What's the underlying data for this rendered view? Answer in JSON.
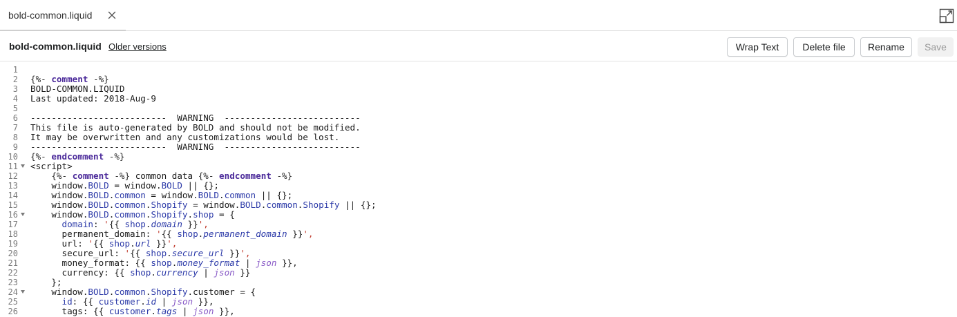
{
  "tab": {
    "label": "bold-common.liquid",
    "close_icon": "close-icon"
  },
  "toolbar": {
    "expand_icon": "expand-icon",
    "file_title": "bold-common.liquid",
    "older_versions": "Older versions",
    "wrap_text": "Wrap Text",
    "delete_file": "Delete file",
    "rename": "Rename",
    "save": "Save"
  },
  "colors": {
    "keyword": "#4b2a9a",
    "object": "#2c3aa8",
    "string": "#c0392b",
    "filter": "#8a5cc7",
    "line_number": "#7a7a7a"
  },
  "editor": {
    "lines": [
      {
        "n": "1",
        "fold": false,
        "tokens": []
      },
      {
        "n": "2",
        "fold": false,
        "tokens": [
          [
            "d",
            "{%- "
          ],
          [
            "k",
            "comment"
          ],
          [
            "d",
            " -%}"
          ]
        ]
      },
      {
        "n": "3",
        "fold": false,
        "tokens": [
          [
            "t",
            "BOLD-COMMON.LIQUID"
          ]
        ]
      },
      {
        "n": "4",
        "fold": false,
        "tokens": [
          [
            "t",
            "Last updated: 2018-Aug-9"
          ]
        ]
      },
      {
        "n": "5",
        "fold": false,
        "tokens": []
      },
      {
        "n": "6",
        "fold": false,
        "tokens": [
          [
            "t",
            "--------------------------  WARNING  --------------------------"
          ]
        ]
      },
      {
        "n": "7",
        "fold": false,
        "tokens": [
          [
            "t",
            "This file is auto-generated by BOLD and should not be modified."
          ]
        ]
      },
      {
        "n": "8",
        "fold": false,
        "tokens": [
          [
            "t",
            "It may be overwritten and any customizations would be lost."
          ]
        ]
      },
      {
        "n": "9",
        "fold": false,
        "tokens": [
          [
            "t",
            "--------------------------  WARNING  --------------------------"
          ]
        ]
      },
      {
        "n": "10",
        "fold": false,
        "tokens": [
          [
            "d",
            "{%- "
          ],
          [
            "k",
            "endcomment"
          ],
          [
            "d",
            " -%}"
          ]
        ]
      },
      {
        "n": "11",
        "fold": true,
        "tokens": [
          [
            "t",
            "<script>"
          ]
        ]
      },
      {
        "n": "12",
        "fold": false,
        "tokens": [
          [
            "t",
            "    "
          ],
          [
            "d",
            "{%- "
          ],
          [
            "k",
            "comment"
          ],
          [
            "d",
            " -%}"
          ],
          [
            "t",
            " common data "
          ],
          [
            "d",
            "{%- "
          ],
          [
            "k",
            "endcomment"
          ],
          [
            "d",
            " -%}"
          ]
        ]
      },
      {
        "n": "13",
        "fold": false,
        "tokens": [
          [
            "t",
            "    window."
          ],
          [
            "o",
            "BOLD"
          ],
          [
            "t",
            " = window."
          ],
          [
            "o",
            "BOLD"
          ],
          [
            "t",
            " || {};"
          ]
        ]
      },
      {
        "n": "14",
        "fold": false,
        "tokens": [
          [
            "t",
            "    window."
          ],
          [
            "o",
            "BOLD"
          ],
          [
            "t",
            "."
          ],
          [
            "o",
            "common"
          ],
          [
            "t",
            " = window."
          ],
          [
            "o",
            "BOLD"
          ],
          [
            "t",
            "."
          ],
          [
            "o",
            "common"
          ],
          [
            "t",
            " || {};"
          ]
        ]
      },
      {
        "n": "15",
        "fold": false,
        "tokens": [
          [
            "t",
            "    window."
          ],
          [
            "o",
            "BOLD"
          ],
          [
            "t",
            "."
          ],
          [
            "o",
            "common"
          ],
          [
            "t",
            "."
          ],
          [
            "o",
            "Shopify"
          ],
          [
            "t",
            " = window."
          ],
          [
            "o",
            "BOLD"
          ],
          [
            "t",
            "."
          ],
          [
            "o",
            "common"
          ],
          [
            "t",
            "."
          ],
          [
            "o",
            "Shopify"
          ],
          [
            "t",
            " || {};"
          ]
        ]
      },
      {
        "n": "16",
        "fold": true,
        "tokens": [
          [
            "t",
            "    window."
          ],
          [
            "o",
            "BOLD"
          ],
          [
            "t",
            "."
          ],
          [
            "o",
            "common"
          ],
          [
            "t",
            "."
          ],
          [
            "o",
            "Shopify"
          ],
          [
            "t",
            "."
          ],
          [
            "o",
            "shop"
          ],
          [
            "t",
            " = {"
          ]
        ]
      },
      {
        "n": "17",
        "fold": false,
        "tokens": [
          [
            "t",
            "      "
          ],
          [
            "o",
            "domain"
          ],
          [
            "t",
            ": "
          ],
          [
            "s",
            "'"
          ],
          [
            "t",
            "{{ "
          ],
          [
            "o",
            "shop"
          ],
          [
            "t",
            "."
          ],
          [
            "p",
            "domain"
          ],
          [
            "t",
            " }}"
          ],
          [
            "s",
            "',"
          ]
        ]
      },
      {
        "n": "18",
        "fold": false,
        "tokens": [
          [
            "t",
            "      permanent_domain: "
          ],
          [
            "s",
            "'"
          ],
          [
            "t",
            "{{ "
          ],
          [
            "o",
            "shop"
          ],
          [
            "t",
            "."
          ],
          [
            "p",
            "permanent_domain"
          ],
          [
            "t",
            " }}"
          ],
          [
            "s",
            "',"
          ]
        ]
      },
      {
        "n": "19",
        "fold": false,
        "tokens": [
          [
            "t",
            "      url: "
          ],
          [
            "s",
            "'"
          ],
          [
            "t",
            "{{ "
          ],
          [
            "o",
            "shop"
          ],
          [
            "t",
            "."
          ],
          [
            "p",
            "url"
          ],
          [
            "t",
            " }}"
          ],
          [
            "s",
            "',"
          ]
        ]
      },
      {
        "n": "20",
        "fold": false,
        "tokens": [
          [
            "t",
            "      secure_url: "
          ],
          [
            "s",
            "'"
          ],
          [
            "t",
            "{{ "
          ],
          [
            "o",
            "shop"
          ],
          [
            "t",
            "."
          ],
          [
            "p",
            "secure_url"
          ],
          [
            "t",
            " }}"
          ],
          [
            "s",
            "',"
          ]
        ]
      },
      {
        "n": "21",
        "fold": false,
        "tokens": [
          [
            "t",
            "      money_format: {{ "
          ],
          [
            "o",
            "shop"
          ],
          [
            "t",
            "."
          ],
          [
            "p",
            "money_format"
          ],
          [
            "t",
            " | "
          ],
          [
            "f",
            "json"
          ],
          [
            "t",
            " }},"
          ]
        ]
      },
      {
        "n": "22",
        "fold": false,
        "tokens": [
          [
            "t",
            "      currency: {{ "
          ],
          [
            "o",
            "shop"
          ],
          [
            "t",
            "."
          ],
          [
            "p",
            "currency"
          ],
          [
            "t",
            " | "
          ],
          [
            "f",
            "json"
          ],
          [
            "t",
            " }}"
          ]
        ]
      },
      {
        "n": "23",
        "fold": false,
        "tokens": [
          [
            "t",
            "    };"
          ]
        ]
      },
      {
        "n": "24",
        "fold": true,
        "tokens": [
          [
            "t",
            "    window."
          ],
          [
            "o",
            "BOLD"
          ],
          [
            "t",
            "."
          ],
          [
            "o",
            "common"
          ],
          [
            "t",
            "."
          ],
          [
            "o",
            "Shopify"
          ],
          [
            "t",
            ".customer = {"
          ]
        ]
      },
      {
        "n": "25",
        "fold": false,
        "tokens": [
          [
            "t",
            "      "
          ],
          [
            "o",
            "id"
          ],
          [
            "t",
            ": {{ "
          ],
          [
            "o",
            "customer"
          ],
          [
            "t",
            "."
          ],
          [
            "p",
            "id"
          ],
          [
            "t",
            " | "
          ],
          [
            "f",
            "json"
          ],
          [
            "t",
            " }},"
          ]
        ]
      },
      {
        "n": "26",
        "fold": false,
        "tokens": [
          [
            "t",
            "      tags: {{ "
          ],
          [
            "o",
            "customer"
          ],
          [
            "t",
            "."
          ],
          [
            "p",
            "tags"
          ],
          [
            "t",
            " | "
          ],
          [
            "f",
            "json"
          ],
          [
            "t",
            " }},"
          ]
        ]
      }
    ]
  }
}
